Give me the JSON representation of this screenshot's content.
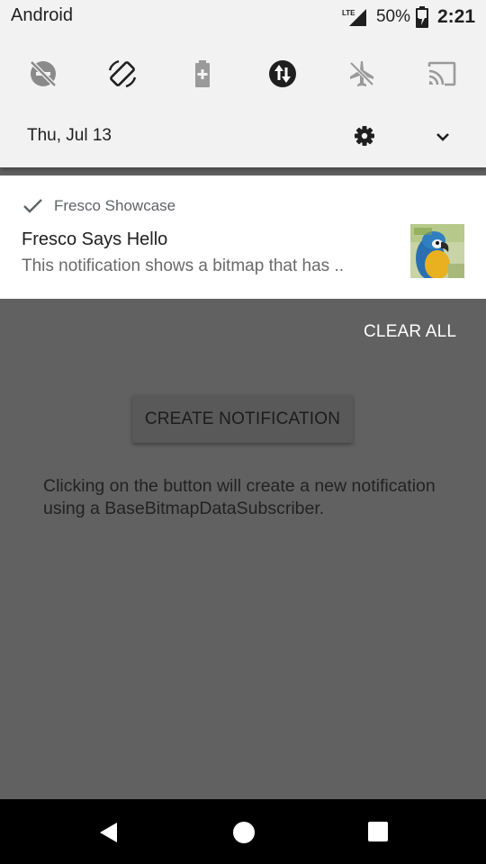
{
  "status_bar": {
    "carrier": "Android",
    "network": "LTE",
    "battery_percent": "50%",
    "time": "2:21"
  },
  "quick_settings": {
    "tiles": [
      {
        "icon": "do-not-disturb-off-icon"
      },
      {
        "icon": "auto-rotate-icon"
      },
      {
        "icon": "battery-saver-icon"
      },
      {
        "icon": "data-saver-icon"
      },
      {
        "icon": "airplane-mode-icon"
      },
      {
        "icon": "cast-icon"
      }
    ],
    "date": "Thu, Jul 13"
  },
  "notification": {
    "app_name": "Fresco Showcase",
    "title": "Fresco Says Hello",
    "body": "This notification shows a bitmap that has ..",
    "thumbnail": "parrot-image"
  },
  "app": {
    "clear_all_label": "CLEAR ALL",
    "create_button_label": "CREATE NOTIFICATION",
    "description": "Clicking on the button will create a new notification using a BaseBitmapDataSubscriber."
  },
  "colors": {
    "shade_background": "#f2f2f2",
    "scrim": "#616161",
    "nav_bar": "#000000",
    "data_saver_tile": "#1f1f1f"
  }
}
